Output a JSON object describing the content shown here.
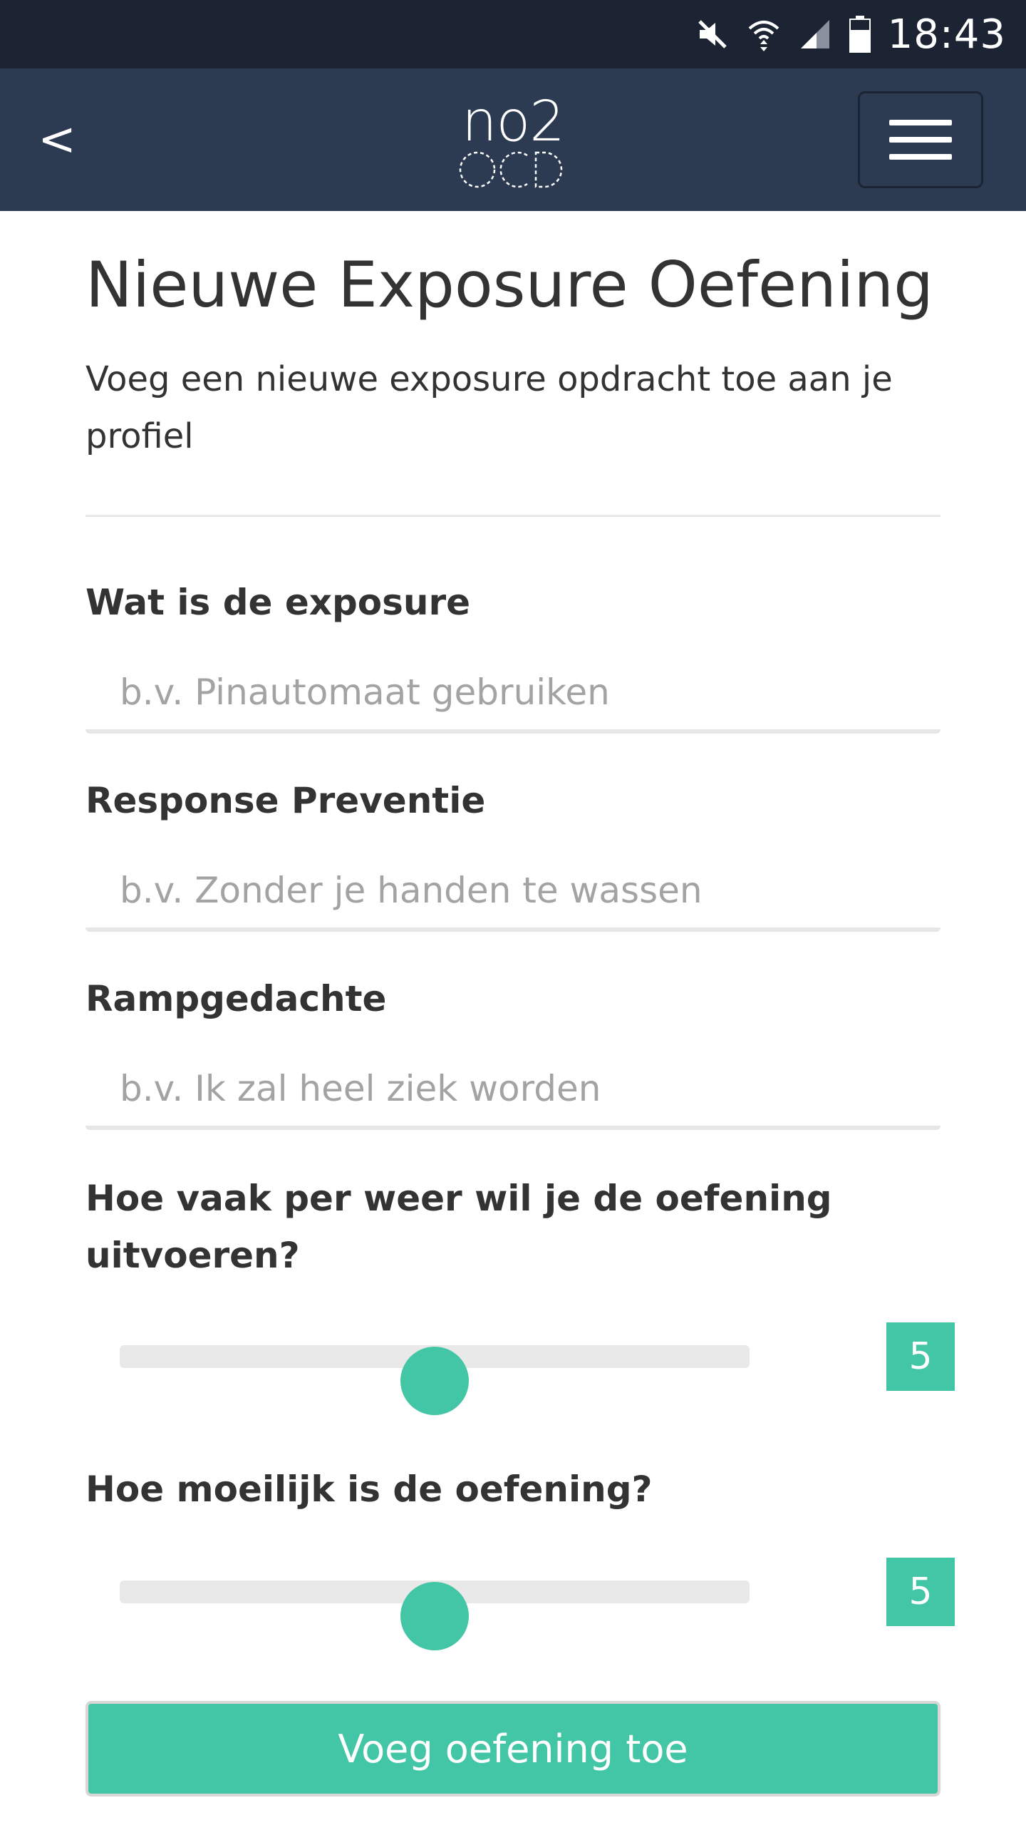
{
  "status_bar": {
    "time": "18:43",
    "icons": [
      "mute-icon",
      "wifi-icon",
      "signal-icon",
      "battery-icon"
    ]
  },
  "header": {
    "back_label": "<",
    "logo_top": "no2",
    "logo_bottom": "OCD",
    "menu_icon": "hamburger-menu-icon"
  },
  "page": {
    "title": "Nieuwe Exposure Oefening",
    "subtitle": "Voeg een nieuwe exposure opdracht toe aan je profiel"
  },
  "form": {
    "exposure": {
      "label": "Wat is de exposure",
      "placeholder": "b.v. Pinautomaat gebruiken",
      "value": ""
    },
    "response_prevention": {
      "label": "Response Preventie",
      "placeholder": "b.v. Zonder je handen te wassen",
      "value": ""
    },
    "disaster_thought": {
      "label": "Rampgedachte",
      "placeholder": "b.v. Ik zal heel ziek worden",
      "value": ""
    },
    "frequency": {
      "label": "Hoe vaak per weer wil je de oefening uitvoeren?",
      "value": "5",
      "min": 0,
      "max": 10
    },
    "difficulty": {
      "label": "Hoe moeilijk is de oefening?",
      "value": "5",
      "min": 0,
      "max": 10
    },
    "submit_label": "Voeg oefening toe"
  },
  "colors": {
    "status_bar": "#1c2433",
    "header": "#2c3a52",
    "accent": "#43c6a5",
    "text": "#333333",
    "placeholder": "#a3a3a3"
  }
}
